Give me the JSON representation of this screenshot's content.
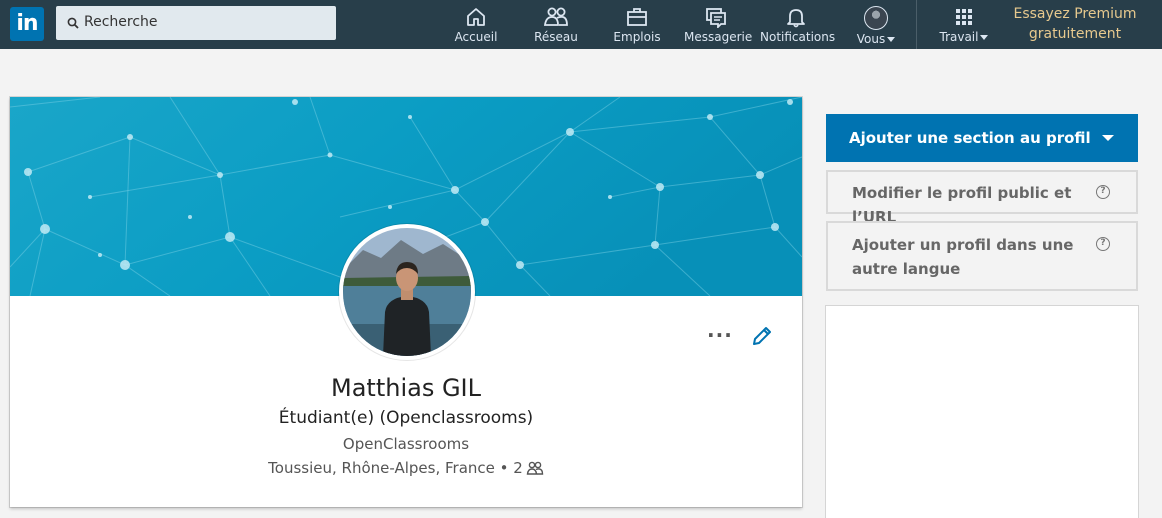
{
  "nav": {
    "logo": "in",
    "search_placeholder": "Recherche",
    "items": [
      {
        "label": "Accueil",
        "icon": "home-icon"
      },
      {
        "label": "Réseau",
        "icon": "network-icon"
      },
      {
        "label": "Emplois",
        "icon": "jobs-icon"
      },
      {
        "label": "Messagerie",
        "icon": "messaging-icon"
      },
      {
        "label": "Notifications",
        "icon": "bell-icon"
      },
      {
        "label": "Vous",
        "icon": "avatar"
      },
      {
        "label": "Travail",
        "icon": "grid-icon"
      }
    ],
    "premium": "Essayez Premium gratuitement"
  },
  "profile": {
    "name": "Matthias GIL",
    "headline": "Étudiant(e) (Openclassrooms)",
    "company": "OpenClassrooms",
    "location": "Toussieu, Rhône-Alpes, France",
    "connections": "2",
    "more_menu": "···"
  },
  "sidebar": {
    "add_section": "Ajouter une section au profil",
    "edit_public": "Modifier le profil public et l’URL",
    "add_language": "Ajouter un profil dans une autre langue"
  },
  "colors": {
    "nav_bg": "#283e4a",
    "brand_blue": "#0073b1",
    "premium_gold": "#e7c98e",
    "banner_teal": "#0a9fc6"
  }
}
